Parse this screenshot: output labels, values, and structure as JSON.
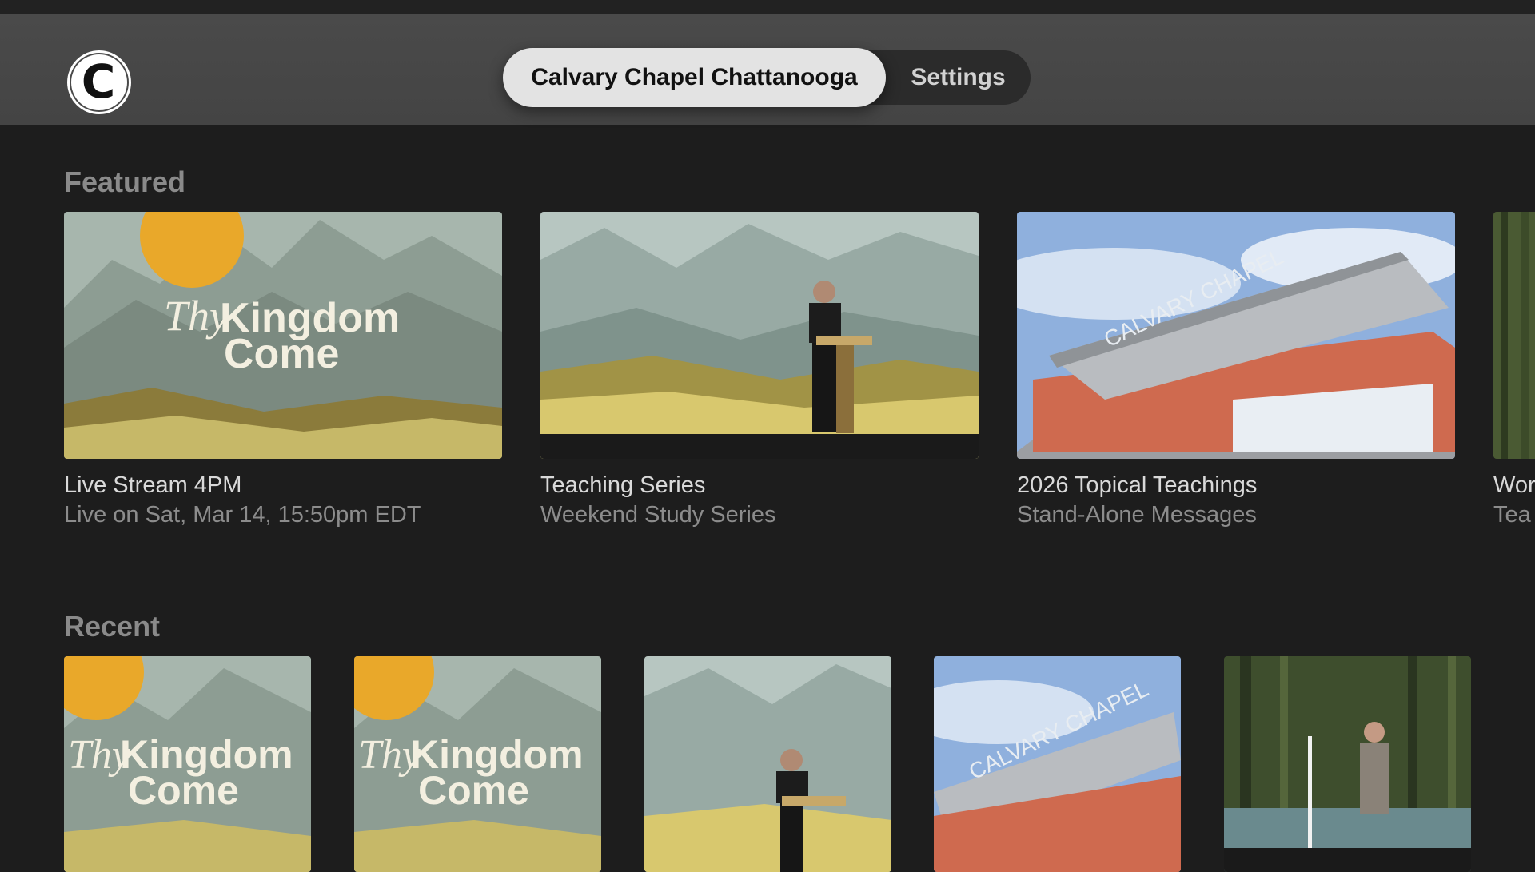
{
  "app": {
    "logo_letter": "C"
  },
  "nav": {
    "tabs": [
      {
        "label": "Calvary Chapel Chattanooga",
        "active": true
      },
      {
        "label": "Settings",
        "active": false
      }
    ]
  },
  "featured": {
    "title": "Featured",
    "items": [
      {
        "title": "Live Stream 4PM",
        "subtitle": "Live on Sat, Mar 14, 15:50pm EDT",
        "art": "Thy Kingdom Come"
      },
      {
        "title": "Teaching Series",
        "subtitle": "Weekend Study Series"
      },
      {
        "title": "2026 Topical Teachings",
        "subtitle": "Stand-Alone Messages",
        "art": "CALVARY CHAPEL"
      },
      {
        "title": "Wor",
        "subtitle": "Tea"
      }
    ]
  },
  "recent": {
    "title": "Recent",
    "items": [
      {
        "art": "Thy Kingdom Come"
      },
      {
        "art": "Thy Kingdom Come"
      },
      {
        "art": ""
      },
      {
        "art": "CALVARY CHAPEL"
      },
      {
        "art": ""
      }
    ]
  },
  "art_text": {
    "thy": "Thy",
    "kingdom": "Kingdom",
    "come": "Come",
    "building": "CALVARY CHAPEL"
  }
}
